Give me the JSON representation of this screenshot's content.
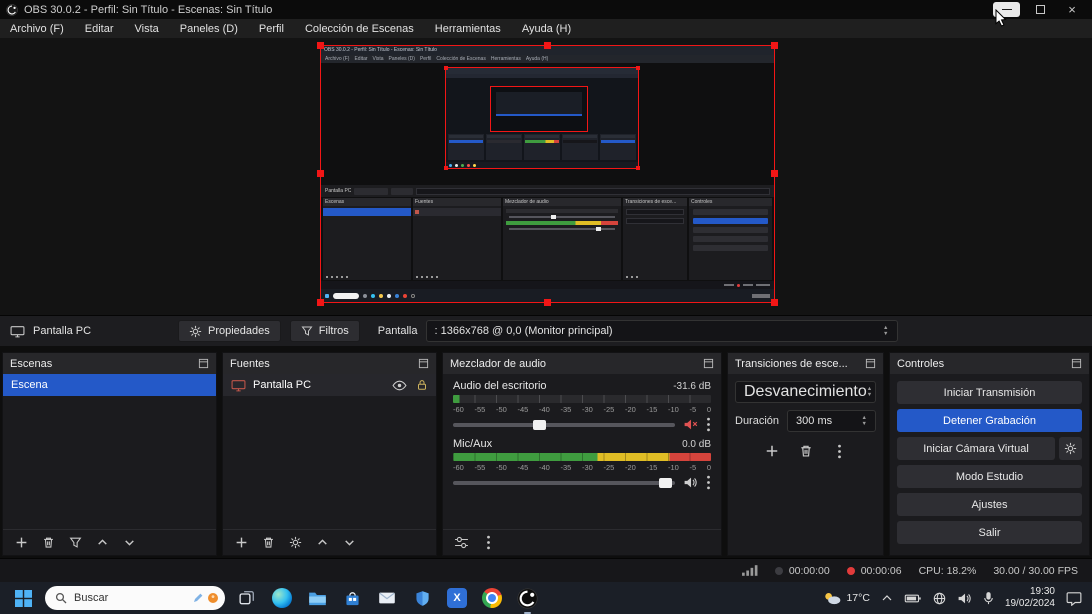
{
  "accent_color": "#2459c8",
  "window": {
    "title": "OBS 30.0.2 - Perfil: Sin Título - Escenas: Sin Título",
    "close_glyph": "×"
  },
  "menu": {
    "items": [
      "Archivo (F)",
      "Editar",
      "Vista",
      "Paneles (D)",
      "Perfil",
      "Colección de Escenas",
      "Herramientas",
      "Ayuda (H)"
    ]
  },
  "source_toolbar": {
    "source_label": "Pantalla PC",
    "properties": "Propiedades",
    "filters": "Filtros",
    "field_label": "Pantalla",
    "field_value": ": 1366x768 @ 0,0 (Monitor principal)"
  },
  "scenes": {
    "title": "Escenas",
    "items": [
      {
        "label": "Escena"
      }
    ]
  },
  "sources": {
    "title": "Fuentes",
    "items": [
      {
        "label": "Pantalla PC"
      }
    ]
  },
  "mixer": {
    "title": "Mezclador de audio",
    "channels": [
      {
        "name": "Audio del escritorio",
        "level": "-31.6 dB"
      },
      {
        "name": "Mic/Aux",
        "level": "0.0 dB"
      }
    ],
    "scale": [
      "-60",
      "-55",
      "-50",
      "-45",
      "-40",
      "-35",
      "-30",
      "-25",
      "-20",
      "-15",
      "-10",
      "-5",
      "0"
    ]
  },
  "transitions": {
    "title": "Transiciones de esce...",
    "selected": "Desvanecimiento",
    "duration_label": "Duración",
    "duration_value": "300 ms"
  },
  "controls": {
    "title": "Controles",
    "start_stream": "Iniciar Transmisión",
    "stop_record": "Detener Grabación",
    "virtual_cam": "Iniciar Cámara Virtual",
    "studio_mode": "Modo Estudio",
    "settings": "Ajustes",
    "exit": "Salir"
  },
  "statusbar": {
    "stream_time": "00:00:00",
    "rec_time": "00:00:06",
    "cpu": "CPU: 18.2%",
    "fps": "30.00 / 30.00 FPS"
  },
  "taskbar": {
    "search": "Buscar",
    "temperature": "17°C",
    "time": "19:30",
    "date": "19/02/2024"
  }
}
